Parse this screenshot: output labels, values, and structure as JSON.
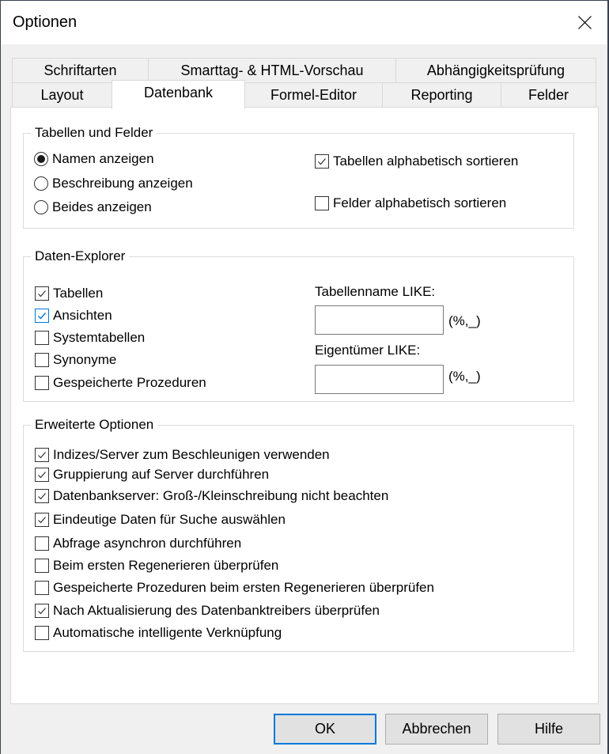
{
  "window": {
    "title": "Optionen",
    "close_icon": "close-x-icon"
  },
  "tabs": {
    "row1": [
      {
        "label": "Schriftarten"
      },
      {
        "label": "Smarttag- & HTML-Vorschau"
      },
      {
        "label": "Abhängigkeitsprüfung"
      }
    ],
    "row2": [
      {
        "label": "Layout"
      },
      {
        "label": "Datenbank",
        "active": true
      },
      {
        "label": "Formel-Editor"
      },
      {
        "label": "Reporting"
      },
      {
        "label": "Felder"
      }
    ]
  },
  "tabellen_und_felder": {
    "legend": "Tabellen und Felder",
    "radios": [
      {
        "label": "Namen anzeigen",
        "selected": true
      },
      {
        "label": "Beschreibung anzeigen",
        "selected": false
      },
      {
        "label": "Beides anzeigen",
        "selected": false
      }
    ],
    "checkboxes": [
      {
        "label": "Tabellen alphabetisch sortieren",
        "checked": true
      },
      {
        "label": "Felder alphabetisch sortieren",
        "checked": false
      }
    ]
  },
  "daten_explorer": {
    "legend": "Daten-Explorer",
    "checkboxes": [
      {
        "label": "Tabellen",
        "checked": true
      },
      {
        "label": "Ansichten",
        "checked": true,
        "hover": true
      },
      {
        "label": "Systemtabellen",
        "checked": false
      },
      {
        "label": "Synonyme",
        "checked": false
      },
      {
        "label": "Gespeicherte Prozeduren",
        "checked": false
      }
    ],
    "tabellenname_label": "Tabellenname LIKE:",
    "tabellenname_value": "",
    "tabellenname_hint": "(%,_)",
    "eigentuemer_label": "Eigentümer LIKE:",
    "eigentuemer_value": "",
    "eigentuemer_hint": "(%,_)"
  },
  "erweiterte_optionen": {
    "legend": "Erweiterte Optionen",
    "checkboxes": [
      {
        "label": "Indizes/Server zum Beschleunigen verwenden",
        "checked": true
      },
      {
        "label": "Gruppierung auf Server durchführen",
        "checked": true
      },
      {
        "label": "Datenbankserver: Groß-/Kleinschreibung nicht beachten",
        "checked": true
      },
      {
        "label": "Eindeutige Daten für Suche auswählen",
        "checked": true
      },
      {
        "label": "Abfrage asynchron durchführen",
        "checked": false
      },
      {
        "label": "Beim ersten Regenerieren überprüfen",
        "checked": false
      },
      {
        "label": "Gespeicherte Prozeduren beim ersten Regenerieren überprüfen",
        "checked": false
      },
      {
        "label": "Nach Aktualisierung des Datenbanktreibers überprüfen",
        "checked": true
      },
      {
        "label": "Automatische intelligente Verknüpfung",
        "checked": false
      }
    ]
  },
  "buttons": {
    "ok": "OK",
    "cancel": "Abbrechen",
    "help": "Hilfe"
  },
  "colors": {
    "accent": "#0078d7",
    "window_bg": "#f0f0f0",
    "panel_bg": "#ffffff"
  }
}
